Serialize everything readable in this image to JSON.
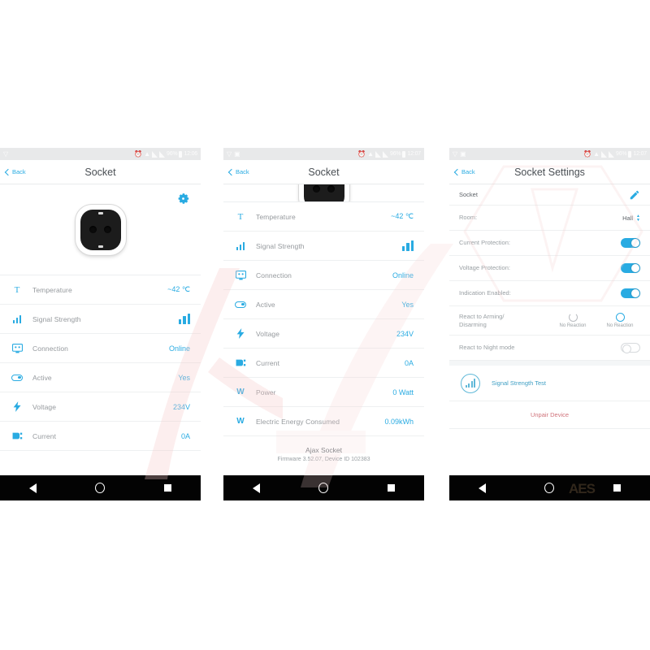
{
  "status_bar": {
    "battery": "96%",
    "time_1": "12:06",
    "time_2": "12:07",
    "time_3": "12:07",
    "icons": [
      "alarm-clock-icon",
      "wifi-icon",
      "signal-icon",
      "signal-icon",
      "battery-icon"
    ]
  },
  "nav": {
    "back_label": "Back"
  },
  "android_nav": {
    "back": "back-triangle",
    "home": "home-circle",
    "recents": "recents-square"
  },
  "screen1": {
    "title": "Socket",
    "gear_icon": "gear-icon",
    "device_image": "smart-socket-image",
    "rows": [
      {
        "icon": "thermometer-icon",
        "label": "Temperature",
        "value": "~42 ℃"
      },
      {
        "icon": "signal-bars-icon",
        "label": "Signal Strength",
        "value": ""
      },
      {
        "icon": "connection-icon",
        "label": "Connection",
        "value": "Online"
      },
      {
        "icon": "toggle-icon",
        "label": "Active",
        "value": "Yes"
      },
      {
        "icon": "voltage-icon",
        "label": "Voltage",
        "value": "234V"
      },
      {
        "icon": "current-plug-icon",
        "label": "Current",
        "value": "0A"
      }
    ]
  },
  "screen2": {
    "title": "Socket",
    "device_image": "smart-socket-image-clipped",
    "rows": [
      {
        "icon": "thermometer-icon",
        "label": "Temperature",
        "value": "~42 ℃"
      },
      {
        "icon": "signal-bars-icon",
        "label": "Signal Strength",
        "value": ""
      },
      {
        "icon": "connection-icon",
        "label": "Connection",
        "value": "Online"
      },
      {
        "icon": "toggle-icon",
        "label": "Active",
        "value": "Yes"
      },
      {
        "icon": "voltage-icon",
        "label": "Voltage",
        "value": "234V"
      },
      {
        "icon": "current-plug-icon",
        "label": "Current",
        "value": "0A"
      },
      {
        "icon": "watt-icon",
        "label": "Power",
        "value": "0 Watt"
      },
      {
        "icon": "watt-icon",
        "label": "Electric Energy Consumed",
        "value": "0.09kWh"
      }
    ],
    "footer": {
      "device_name": "Ajax Socket",
      "firmware": "Firmware 3.52.07, Device ID 102383"
    }
  },
  "screen3": {
    "title": "Socket Settings",
    "device_name": "Socket",
    "edit_icon": "pencil-icon",
    "settings": [
      {
        "label": "Room:",
        "type": "select",
        "value": "Hall"
      },
      {
        "label": "Current Protection:",
        "type": "switch",
        "value": "on"
      },
      {
        "label": "Voltage Protection:",
        "type": "switch",
        "value": "on"
      },
      {
        "label": "Indication Enabled:",
        "type": "switch",
        "value": "on"
      }
    ],
    "react_arming": {
      "label": "React to Arming/\nDisarming",
      "option_arm": "No Reaction",
      "option_disarm": "No Reaction"
    },
    "react_night": {
      "label": "React to Night mode",
      "value": "off"
    },
    "signal_test": {
      "label": "Signal Strength Test",
      "icon": "signal-bars-circle-icon"
    },
    "unpair": {
      "label": "Unpair Device"
    }
  },
  "colors": {
    "accent": "#29abe2",
    "label": "#9aa0a4",
    "danger": "#d0737b",
    "statusbar_bg": "#e8e9ea",
    "navbar_bg": "#030303"
  },
  "watermark": {
    "text": "AES"
  }
}
